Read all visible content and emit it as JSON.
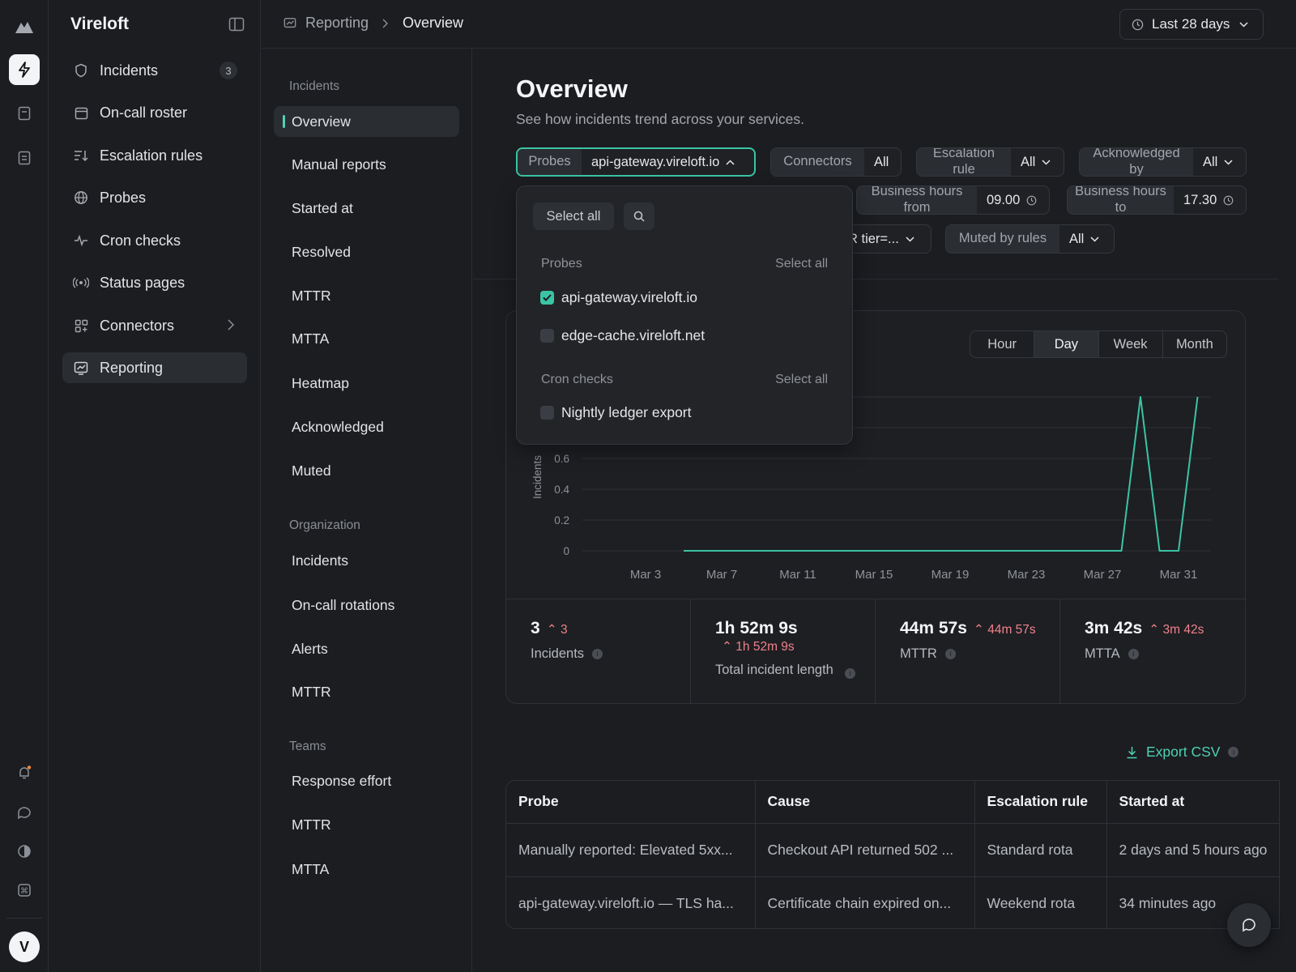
{
  "app": {
    "name": "Vireloft",
    "avatar_letter": "V"
  },
  "sidebar": {
    "items": [
      {
        "label": "Incidents",
        "icon": "shield-icon",
        "badge": "3"
      },
      {
        "label": "On-call roster",
        "icon": "calendar-icon"
      },
      {
        "label": "Escalation rules",
        "icon": "sort-icon"
      },
      {
        "label": "Probes",
        "icon": "globe-icon"
      },
      {
        "label": "Cron checks",
        "icon": "pulse-icon"
      },
      {
        "label": "Status pages",
        "icon": "broadcast-icon"
      },
      {
        "label": "Connectors",
        "icon": "grid-plus-icon"
      },
      {
        "label": "Reporting",
        "icon": "chart-icon"
      }
    ]
  },
  "breadcrumb": {
    "parent": "Reporting",
    "current": "Overview"
  },
  "date_range": "Last 28 days",
  "subnav": {
    "sections": [
      {
        "heading": "Incidents",
        "items": [
          "Overview",
          "Manual reports",
          "Started at",
          "Resolved",
          "MTTR",
          "MTTA",
          "Heatmap",
          "Acknowledged",
          "Muted"
        ]
      },
      {
        "heading": "Organization",
        "items": [
          "Incidents",
          "On-call rotations",
          "Alerts",
          "MTTR"
        ]
      },
      {
        "heading": "Teams",
        "items": [
          "Response effort",
          "MTTR",
          "MTTA"
        ]
      }
    ]
  },
  "page": {
    "title": "Overview",
    "subtitle": "See how incidents trend across your services."
  },
  "filters": {
    "probes": {
      "label": "Probes",
      "value": "api-gateway.vireloft.io"
    },
    "connectors": {
      "label": "Connectors",
      "value": "All"
    },
    "escalation": {
      "label": "Escalation rule",
      "value": "All"
    },
    "acknowledged": {
      "label": "Acknowledged by",
      "value": "All"
    },
    "bh_from": {
      "label": "Business hours from",
      "value": "09.00"
    },
    "bh_to": {
      "label": "Business hours to",
      "value": "17.30"
    },
    "tier": {
      "value": "R tier=..."
    },
    "muted": {
      "label": "Muted by rules",
      "value": "All"
    }
  },
  "dropdown": {
    "select_all": "Select all",
    "groups": [
      {
        "heading": "Probes",
        "select_all": "Select all",
        "options": [
          {
            "label": "api-gateway.vireloft.io",
            "checked": true
          },
          {
            "label": "edge-cache.vireloft.net",
            "checked": false
          }
        ]
      },
      {
        "heading": "Cron checks",
        "select_all": "Select all",
        "options": [
          {
            "label": "Nightly ledger export",
            "checked": false
          }
        ]
      }
    ]
  },
  "granularity": {
    "options": [
      "Hour",
      "Day",
      "Week",
      "Month"
    ],
    "selected": "Day"
  },
  "chart_data": {
    "type": "line",
    "ylabel": "Incidents",
    "y_ticks": [
      "0",
      "0.2",
      "0.4",
      "0.6"
    ],
    "ylim": [
      0,
      1
    ],
    "x_ticks": [
      "Mar 3",
      "Mar 7",
      "Mar 11",
      "Mar 15",
      "Mar 19",
      "Mar 23",
      "Mar 27",
      "Mar 31"
    ],
    "x": [
      "Mar 5",
      "Mar 6",
      "Mar 7",
      "Mar 8",
      "Mar 9",
      "Mar 10",
      "Mar 11",
      "Mar 12",
      "Mar 13",
      "Mar 14",
      "Mar 15",
      "Mar 16",
      "Mar 17",
      "Mar 18",
      "Mar 19",
      "Mar 20",
      "Mar 21",
      "Mar 22",
      "Mar 23",
      "Mar 24",
      "Mar 25",
      "Mar 26",
      "Mar 27",
      "Mar 28",
      "Mar 29",
      "Mar 30",
      "Mar 31",
      "Apr 1"
    ],
    "series": [
      {
        "values": [
          0,
          0,
          0,
          0,
          0,
          0,
          0,
          0,
          0,
          0,
          0,
          0,
          0,
          0,
          0,
          0,
          0,
          0,
          0,
          0,
          0,
          0,
          0,
          0,
          1,
          0,
          0,
          1
        ]
      }
    ],
    "color": "#3bc4a4",
    "grid": true
  },
  "stats": [
    {
      "value": "3",
      "delta": "3",
      "label": "Incidents"
    },
    {
      "value": "1h 52m 9s",
      "delta": "1h 52m 9s",
      "label": "Total incident length"
    },
    {
      "value": "44m 57s",
      "delta": "44m 57s",
      "label": "MTTR"
    },
    {
      "value": "3m 42s",
      "delta": "3m 42s",
      "label": "MTTA"
    }
  ],
  "export_label": "Export CSV",
  "table": {
    "headers": [
      "Probe",
      "Cause",
      "Escalation rule",
      "Started at"
    ],
    "rows": [
      [
        "Manually reported: Elevated 5xx...",
        "Checkout API returned 502 ...",
        "Standard rota",
        "2 days and 5 hours ago"
      ],
      [
        "api-gateway.vireloft.io — TLS ha...",
        "Certificate chain expired on...",
        "Weekend rota",
        "34 minutes ago"
      ]
    ]
  }
}
